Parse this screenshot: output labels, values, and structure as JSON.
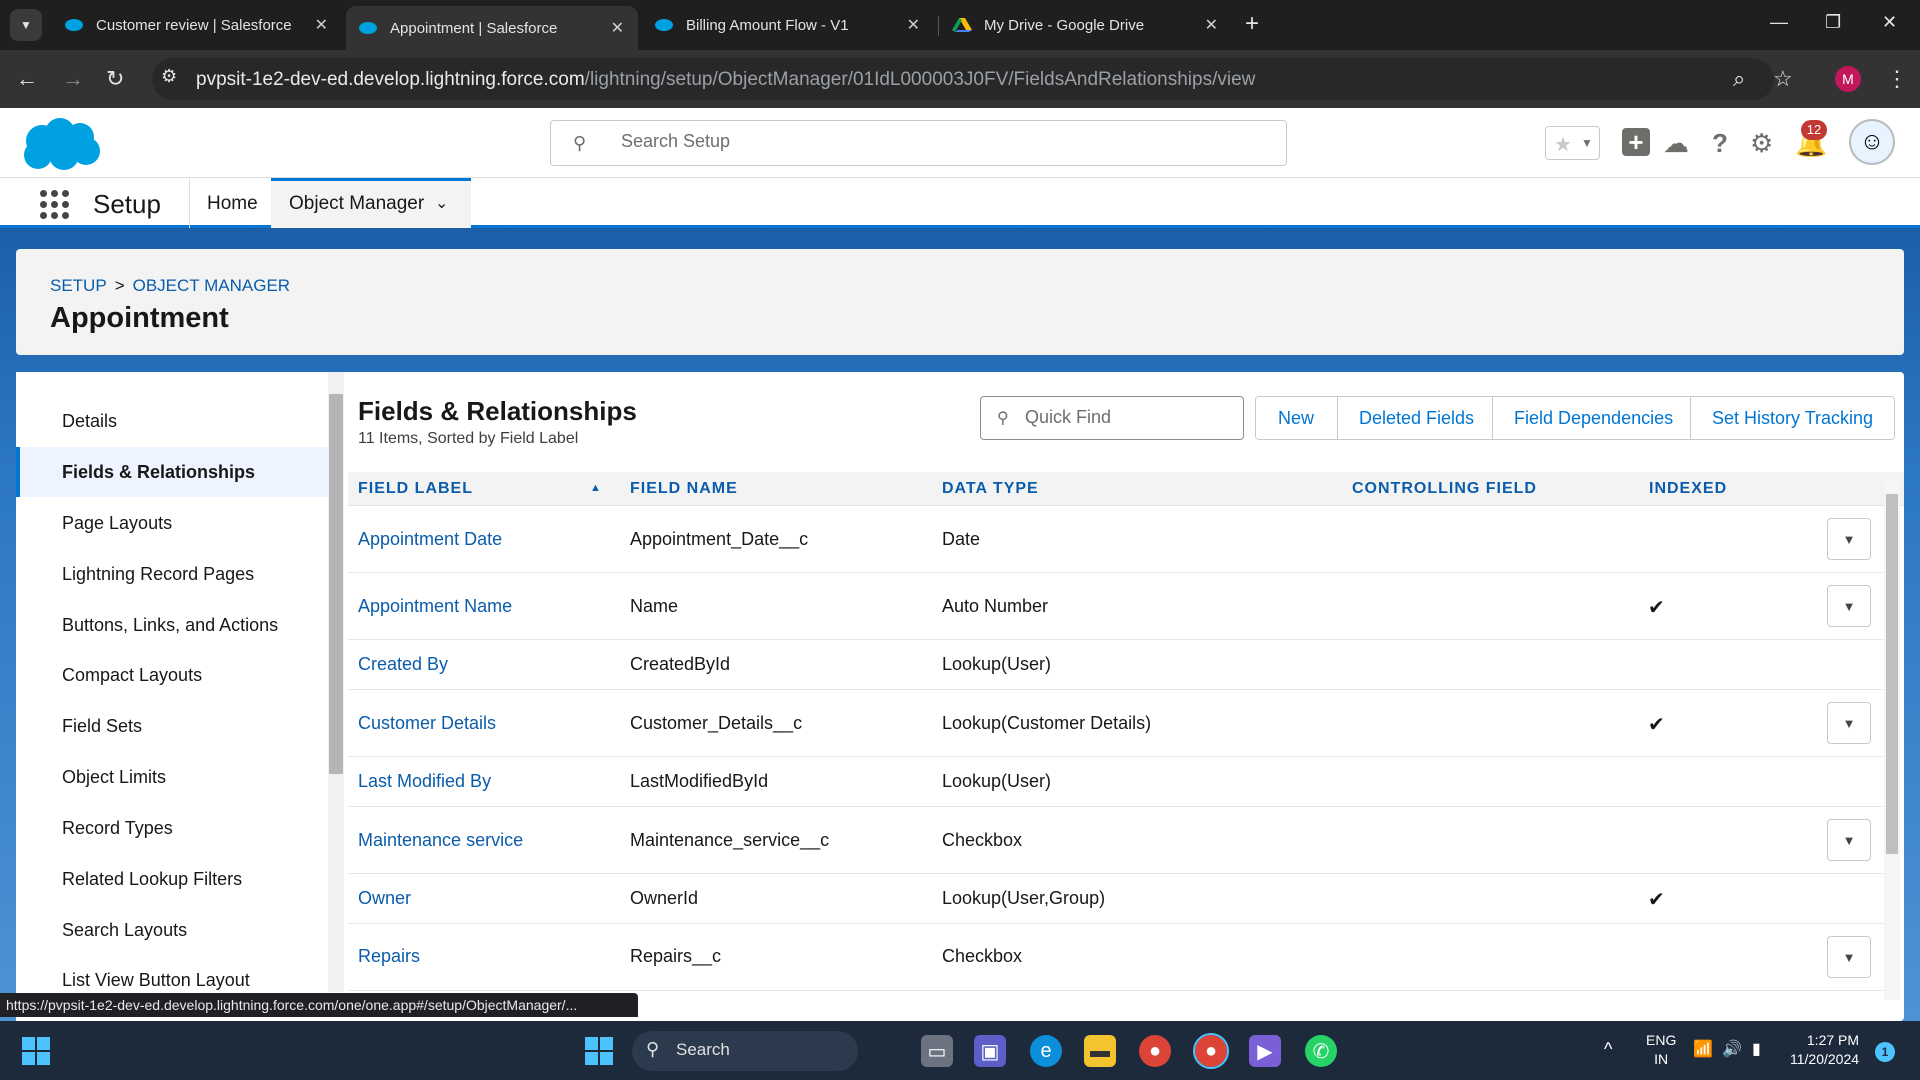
{
  "browser": {
    "tabs": [
      {
        "title": "Customer review | Salesforce"
      },
      {
        "title": "Appointment | Salesforce"
      },
      {
        "title": "Billing Amount Flow - V1"
      },
      {
        "title": "My Drive - Google Drive"
      }
    ],
    "url_host": "pvpsit-1e2-dev-ed.develop.lightning.force.com",
    "url_path": "/lightning/setup/ObjectManager/01IdL000003J0FV/FieldsAndRelationships/view",
    "profile_initial": "M"
  },
  "header": {
    "search_placeholder": "Search Setup",
    "notification_count": "12"
  },
  "appnav": {
    "app_name": "Setup",
    "items": [
      "Home",
      "Object Manager"
    ]
  },
  "breadcrumb": [
    "SETUP",
    ">",
    "OBJECT MANAGER"
  ],
  "object_title": "Appointment",
  "sidebar": {
    "items": [
      "Details",
      "Fields & Relationships",
      "Page Layouts",
      "Lightning Record Pages",
      "Buttons, Links, and Actions",
      "Compact Layouts",
      "Field Sets",
      "Object Limits",
      "Record Types",
      "Related Lookup Filters",
      "Search Layouts",
      "List View Button Layout"
    ],
    "active": "Fields & Relationships"
  },
  "main": {
    "title": "Fields & Relationships",
    "subtitle": "11 Items, Sorted by Field Label",
    "quick_find_placeholder": "Quick Find",
    "buttons": [
      "New",
      "Deleted Fields",
      "Field Dependencies",
      "Set History Tracking"
    ]
  },
  "table": {
    "columns": [
      "FIELD LABEL",
      "FIELD NAME",
      "DATA TYPE",
      "CONTROLLING FIELD",
      "INDEXED"
    ],
    "rows": [
      {
        "label": "Appointment Date",
        "name": "Appointment_Date__c",
        "type": "Date",
        "controlling": "",
        "indexed": false,
        "action": true
      },
      {
        "label": "Appointment Name",
        "name": "Name",
        "type": "Auto Number",
        "controlling": "",
        "indexed": true,
        "action": true
      },
      {
        "label": "Created By",
        "name": "CreatedById",
        "type": "Lookup(User)",
        "controlling": "",
        "indexed": false,
        "action": false
      },
      {
        "label": "Customer Details",
        "name": "Customer_Details__c",
        "type": "Lookup(Customer Details)",
        "controlling": "",
        "indexed": true,
        "action": true
      },
      {
        "label": "Last Modified By",
        "name": "LastModifiedById",
        "type": "Lookup(User)",
        "controlling": "",
        "indexed": false,
        "action": false
      },
      {
        "label": "Maintenance service",
        "name": "Maintenance_service__c",
        "type": "Checkbox",
        "controlling": "",
        "indexed": false,
        "action": true
      },
      {
        "label": "Owner",
        "name": "OwnerId",
        "type": "Lookup(User,Group)",
        "controlling": "",
        "indexed": true,
        "action": false
      },
      {
        "label": "Repairs",
        "name": "Repairs__c",
        "type": "Checkbox",
        "controlling": "",
        "indexed": false,
        "action": true
      }
    ]
  },
  "status_url": "https://pvpsit-1e2-dev-ed.develop.lightning.force.com/one/one.app#/setup/ObjectManager/...",
  "taskbar": {
    "search_label": "Search",
    "language": "ENG",
    "region": "IN",
    "time": "1:27 PM",
    "date": "11/20/2024",
    "notification_badge": "1"
  },
  "colors": {
    "brand_blue": "#0176d3",
    "link_blue": "#0b5cab",
    "chrome_dark": "#1f1f1f"
  }
}
